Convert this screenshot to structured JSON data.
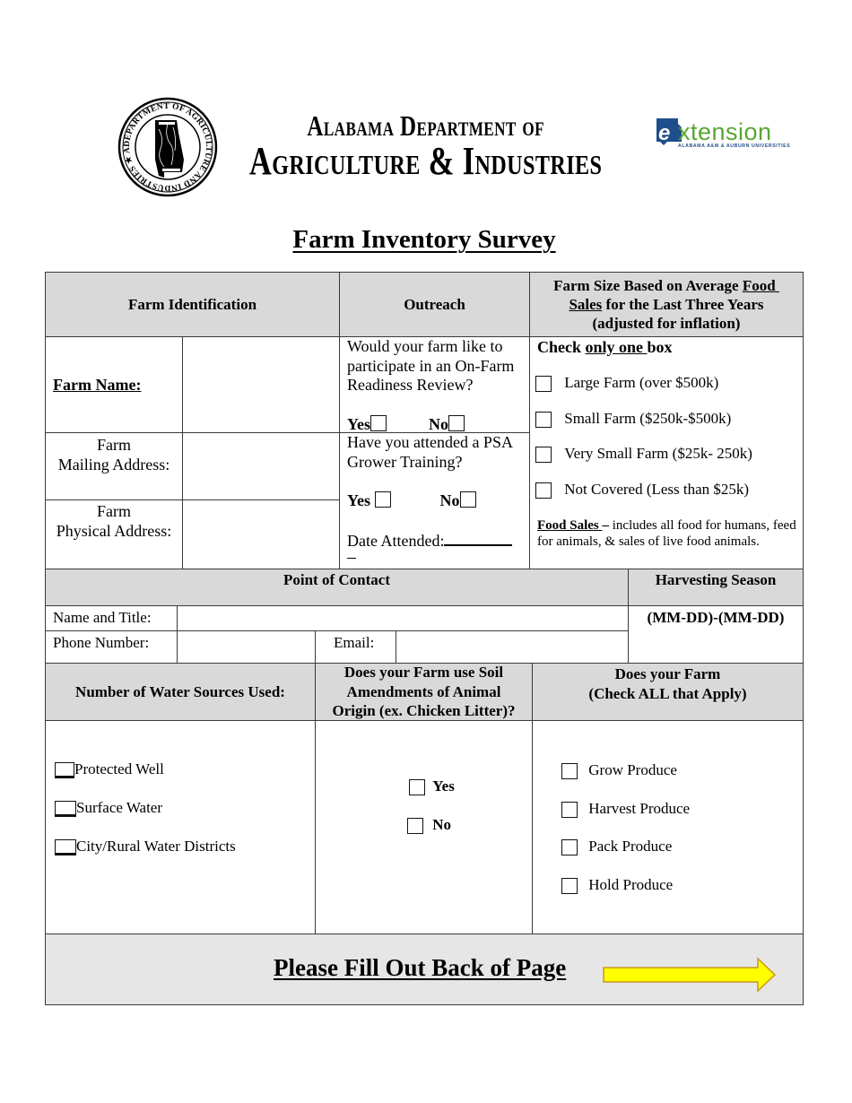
{
  "header": {
    "seal": {
      "icon": "alabama-department-seal-icon",
      "ring_text": "ALABAMA ★ DEPARTMENT OF AGRICULTURE AND INDUSTRIES"
    },
    "dept_line1": "Alabama Department of",
    "dept_line2": "Agriculture & Industries",
    "extension_logo": {
      "icon": "extension-logo-icon",
      "word": "xtension",
      "letter": "e",
      "subtitle": "ALABAMA A&M & AUBURN UNIVERSITIES",
      "green": "#5aa531",
      "blue": "#1f4e8c"
    }
  },
  "title": "Farm Inventory Survey",
  "farm_identification": {
    "heading": "Farm Identification",
    "farm_name_label": "Farm Name:",
    "mailing_label_1": "Farm",
    "mailing_label_2": "Mailing Address:",
    "physical_label_1": "Farm",
    "physical_label_2": "Physical Address:",
    "farm_name_value": "",
    "mailing_value": "",
    "physical_value": ""
  },
  "outreach": {
    "heading": "Outreach",
    "q1": "Would your farm like to participate in an On-Farm Readiness Review?",
    "q1_yes": "Yes",
    "q1_no": "No",
    "q2": "Have you attended a PSA Grower Training?",
    "q2_yes": "Yes",
    "q2_no": "No",
    "date_label": "Date Attended:",
    "date_value": ""
  },
  "farm_size": {
    "heading_pre": "Farm Size Based on Average ",
    "heading_u1": "Food",
    "heading_u2": "Sales",
    "heading_post": " for the Last Three Years",
    "heading_line3": "(adjusted for inflation)",
    "instruction_pre": "Check ",
    "instruction_u": "only one ",
    "instruction_post": "box",
    "options": [
      "Large Farm (over $500k)",
      "Small Farm ($250k-$500k)",
      "Very Small Farm ($25k- 250k)",
      "Not Covered (Less than $25k)"
    ],
    "note_term": "Food Sales ",
    "note_dash": "–",
    "note_text": " includes all food for humans, feed for animals, & sales of live food animals."
  },
  "point_of_contact": {
    "heading": "Point of Contact",
    "name_label": "Name and Title:",
    "phone_label": "Phone Number:",
    "email_label": "Email:",
    "name_value": "",
    "phone_value": "",
    "email_value": ""
  },
  "harvesting_season": {
    "heading": "Harvesting Season",
    "format": "(MM-DD)-(MM-DD)",
    "value": ""
  },
  "water_sources": {
    "heading": "Number of Water Sources Used:",
    "options": [
      "Protected Well",
      "Surface Water",
      "City/Rural Water Districts"
    ]
  },
  "soil_amendments": {
    "heading_1": "Does your Farm use Soil",
    "heading_2": "Amendments of Animal",
    "heading_3": "Origin (ex. Chicken Litter)?",
    "options": [
      "Yes",
      "No"
    ]
  },
  "farm_activities": {
    "heading_1": "Does your Farm",
    "heading_2": "(Check ALL that Apply)",
    "options": [
      "Grow Produce",
      "Harvest Produce",
      "Pack Produce",
      "Hold Produce"
    ]
  },
  "footer": {
    "text": "Please Fill Out Back of Page",
    "arrow_icon": "arrow-right-icon",
    "arrow_fill": "#ffff00",
    "arrow_stroke": "#c8961e"
  }
}
